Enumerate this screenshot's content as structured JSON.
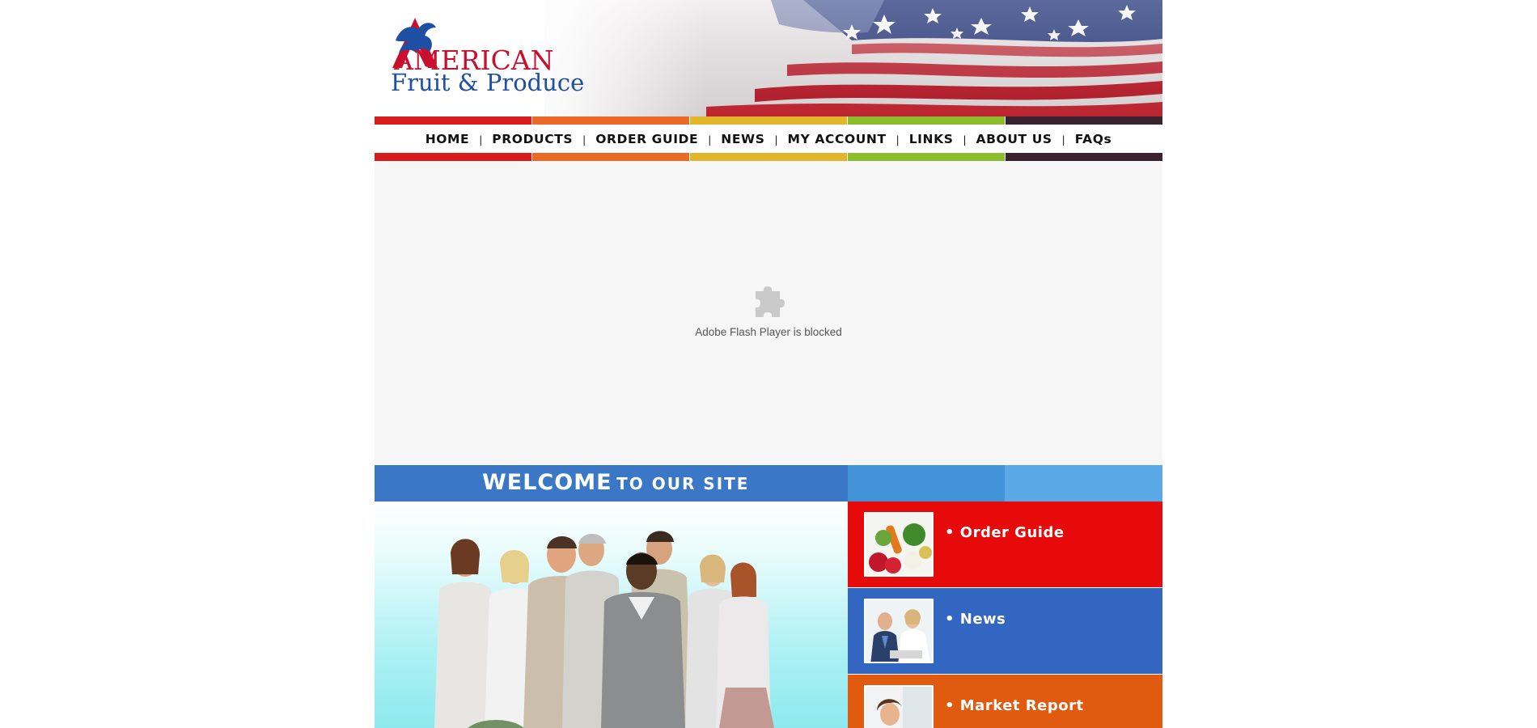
{
  "logo": {
    "line1": "AMERICAN",
    "line2": "Fruit & Produce"
  },
  "nav": {
    "items": [
      {
        "label": "HOME"
      },
      {
        "label": "PRODUCTS"
      },
      {
        "label": "ORDER GUIDE"
      },
      {
        "label": "NEWS"
      },
      {
        "label": "MY ACCOUNT"
      },
      {
        "label": "LINKS"
      },
      {
        "label": "ABOUT US"
      },
      {
        "label": "FAQs"
      }
    ],
    "separator": "|"
  },
  "colorbar": [
    "#d81c1c",
    "#e86a26",
    "#e3b52a",
    "#8cbd2c",
    "#3a2230"
  ],
  "flash": {
    "icon": "puzzle-piece-icon",
    "message": "Adobe Flash Player is blocked"
  },
  "welcome": {
    "big": "WELCOME",
    "small": "TO OUR SITE",
    "colors": [
      "#3a78c7",
      "#3a78c7",
      "#3a78c7",
      "#4393d9",
      "#5aa8e6"
    ]
  },
  "side_links": [
    {
      "label": "• Order Guide",
      "color": "#e60a0a",
      "thumb": "produce-photo"
    },
    {
      "label": "• News",
      "color": "#3366c0",
      "thumb": "meeting-photo"
    },
    {
      "label": "• Market Report",
      "color": "#e05a10",
      "thumb": "woman-photo"
    }
  ]
}
